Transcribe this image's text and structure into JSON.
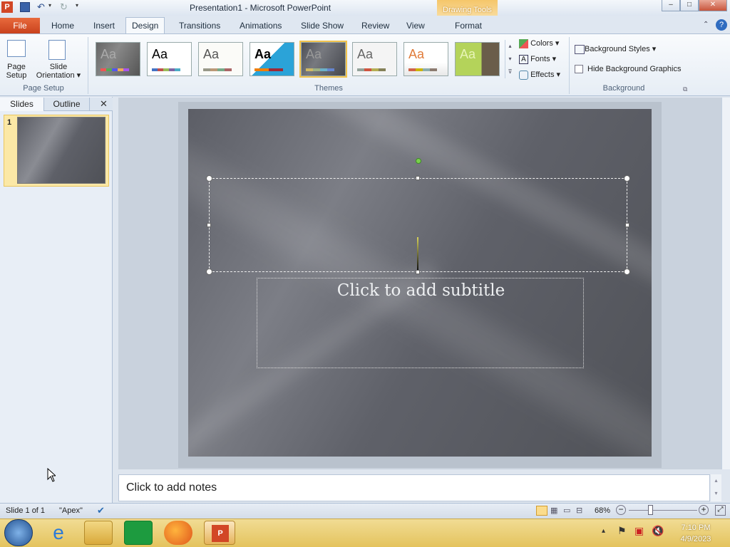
{
  "titlebar": {
    "title": "Presentation1  -  Microsoft PowerPoint",
    "contextual": "Drawing Tools"
  },
  "tabs": [
    "File",
    "Home",
    "Insert",
    "Design",
    "Transitions",
    "Animations",
    "Slide Show",
    "Review",
    "View",
    "Format"
  ],
  "ribbon": {
    "page_setup": {
      "btn1_line1": "Page",
      "btn1_line2": "Setup",
      "btn2_line1": "Slide",
      "btn2_line2": "Orientation",
      "label": "Page Setup"
    },
    "themes": {
      "label": "Themes",
      "aa": "Aa"
    },
    "variants": {
      "colors": "Colors",
      "fonts": "Fonts",
      "effects": "Effects"
    },
    "background": {
      "styles": "Background Styles",
      "hide": "Hide Background Graphics",
      "label": "Background"
    }
  },
  "left_pane": {
    "tab_slides": "Slides",
    "tab_outline": "Outline",
    "slide_number": "1"
  },
  "slide": {
    "subtitle_placeholder": "Click to add subtitle"
  },
  "notes": {
    "placeholder": "Click to add notes"
  },
  "status": {
    "slide": "Slide 1 of 1",
    "theme": "\"Apex\"",
    "zoom": "68%"
  },
  "taskbar": {
    "time": "7:10 PM",
    "date": "4/9/2023"
  },
  "colors": {
    "accent_file": "#d9542a",
    "drawing_tools": "#f5c66a",
    "taskbar": "#e6c560"
  }
}
